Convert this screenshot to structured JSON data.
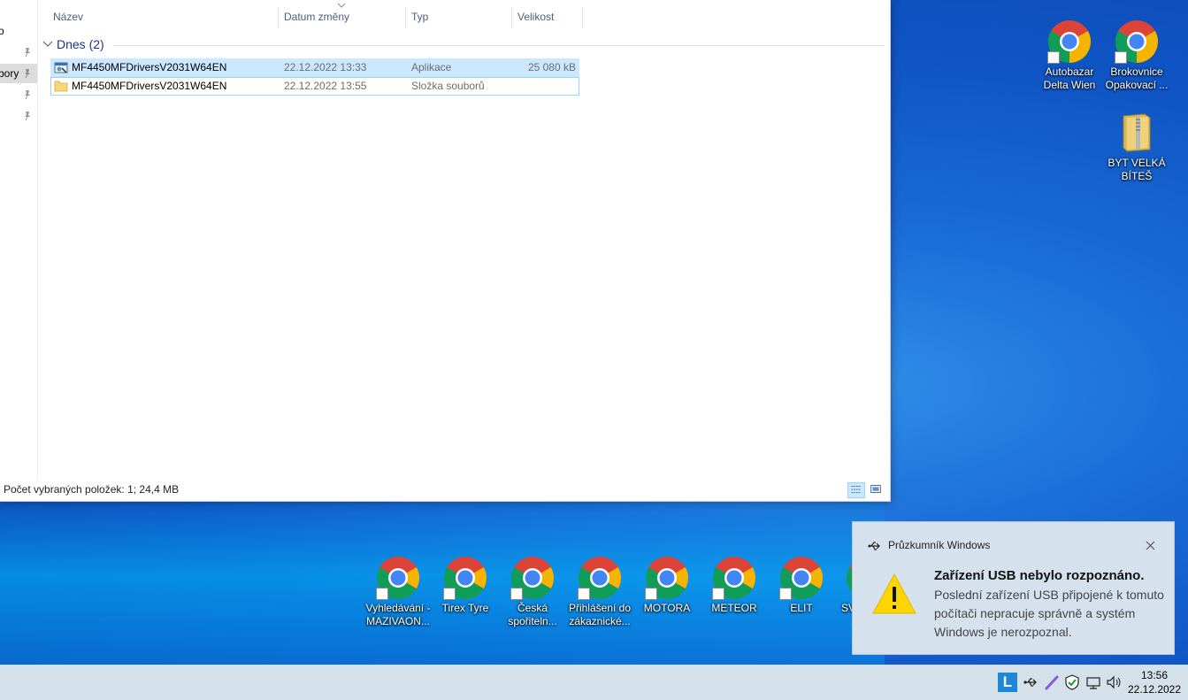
{
  "explorer": {
    "nav_items": [
      {
        "label": "o",
        "pinned": false,
        "selected": false
      },
      {
        "label": "",
        "pinned": true,
        "selected": false
      },
      {
        "label": "bory",
        "pinned": true,
        "selected": true
      },
      {
        "label": "",
        "pinned": true,
        "selected": false
      },
      {
        "label": "",
        "pinned": true,
        "selected": false
      }
    ],
    "columns": {
      "name": "Název",
      "date": "Datum změny",
      "type": "Typ",
      "size": "Velikost"
    },
    "group": {
      "label": "Dnes (2)"
    },
    "files": [
      {
        "name": "MF4450MFDriversV2031W64EN",
        "date": "22.12.2022 13:33",
        "type": "Aplikace",
        "size": "25 080 kB",
        "icon": "application-icon"
      },
      {
        "name": "MF4450MFDriversV2031W64EN",
        "date": "22.12.2022 13:55",
        "type": "Složka souborů",
        "size": "",
        "icon": "folder-icon"
      }
    ],
    "status": "Počet vybraných položek: 1; 24,4 MB"
  },
  "desktop": {
    "right_icons": [
      {
        "label1": "Autobazar",
        "label2": "Delta Wien",
        "icon": "chrome-icon"
      },
      {
        "label1": "Brokovnice",
        "label2": "Opakovací ...",
        "icon": "chrome-icon"
      },
      {
        "label1": "BYT VELKÁ",
        "label2": "BÍTEŠ",
        "icon": "zip-folder-icon"
      }
    ],
    "bottom_icons": [
      {
        "label1": "Vyhledávání -",
        "label2": "MAZIVAON..."
      },
      {
        "label1": "Tirex Tyre",
        "label2": ""
      },
      {
        "label1": "Česká",
        "label2": "spořiteln..."
      },
      {
        "label1": "Přihlášení do",
        "label2": "zákaznické..."
      },
      {
        "label1": "MOTORA",
        "label2": ""
      },
      {
        "label1": "METEOR",
        "label2": ""
      },
      {
        "label1": "ELIT",
        "label2": ""
      },
      {
        "label1": "SV",
        "label2": ""
      }
    ]
  },
  "notification": {
    "app_name": "Průzkumník Windows",
    "title": "Zařízení USB nebylo rozpoznáno.",
    "body": "Poslední zařízení USB připojené k tomuto počítači nepracuje správně a systém Windows je nerozpoznal."
  },
  "taskbar": {
    "time": "13:56",
    "date": "22.12.2022",
    "tray": [
      "l-app-icon",
      "usb-icon",
      "pen-icon",
      "security-shield-icon",
      "network-icon",
      "volume-icon"
    ]
  },
  "colors": {
    "selection": "#cce8ff",
    "group_text": "#1e3287",
    "taskbar": "#d4e0ea",
    "toast": "#d6e1ee"
  }
}
